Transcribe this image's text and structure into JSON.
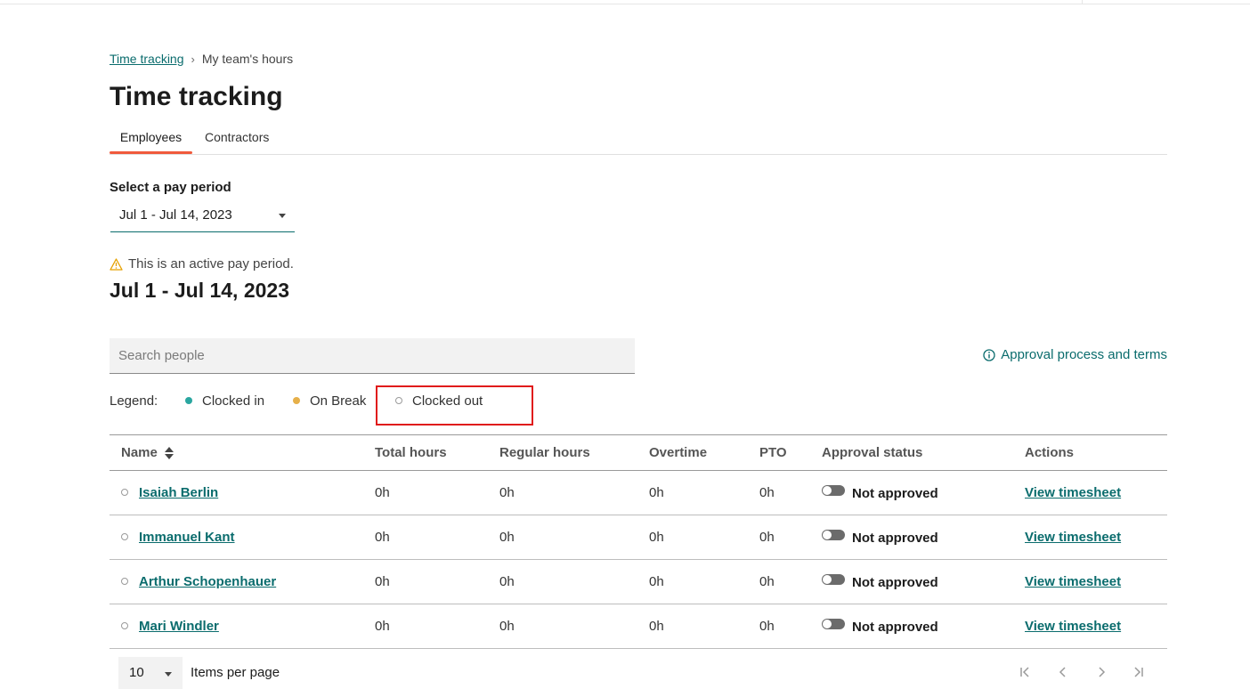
{
  "breadcrumb": {
    "root": "Time tracking",
    "separator": "›",
    "current": "My team's hours"
  },
  "page": {
    "title": "Time tracking"
  },
  "tabs": [
    {
      "label": "Employees"
    },
    {
      "label": "Contractors"
    }
  ],
  "pay_period": {
    "label": "Select a pay period",
    "selected": "Jul 1 - Jul 14, 2023",
    "notice": "This is an active pay period.",
    "heading": "Jul 1 - Jul 14, 2023"
  },
  "search": {
    "placeholder": "Search people"
  },
  "approval_link": "Approval process and terms",
  "legend": {
    "label": "Legend:",
    "items": [
      {
        "label": "Clocked in",
        "color": "#2aa6a0"
      },
      {
        "label": "On Break",
        "color": "#e6b04a"
      },
      {
        "label": "Clocked out",
        "color": "#9a9a9a"
      }
    ]
  },
  "table": {
    "headers": {
      "name": "Name",
      "total": "Total hours",
      "regular": "Regular hours",
      "overtime": "Overtime",
      "pto": "PTO",
      "approval": "Approval status",
      "actions": "Actions"
    },
    "rows": [
      {
        "name": "Isaiah Berlin",
        "total": "0h",
        "regular": "0h",
        "overtime": "0h",
        "pto": "0h",
        "approval": "Not approved",
        "action": "View timesheet"
      },
      {
        "name": "Immanuel Kant",
        "total": "0h",
        "regular": "0h",
        "overtime": "0h",
        "pto": "0h",
        "approval": "Not approved",
        "action": "View timesheet"
      },
      {
        "name": "Arthur Schopenhauer",
        "total": "0h",
        "regular": "0h",
        "overtime": "0h",
        "pto": "0h",
        "approval": "Not approved",
        "action": "View timesheet"
      },
      {
        "name": "Mari Windler",
        "total": "0h",
        "regular": "0h",
        "overtime": "0h",
        "pto": "0h",
        "approval": "Not approved",
        "action": "View timesheet"
      }
    ]
  },
  "pagination": {
    "per_page": "10",
    "per_page_label": "Items per page"
  },
  "colors": {
    "accent": "#0a6c6d",
    "tab_underline": "#f05a3c",
    "highlight": "#e01b1b",
    "warning": "#e6a100"
  }
}
